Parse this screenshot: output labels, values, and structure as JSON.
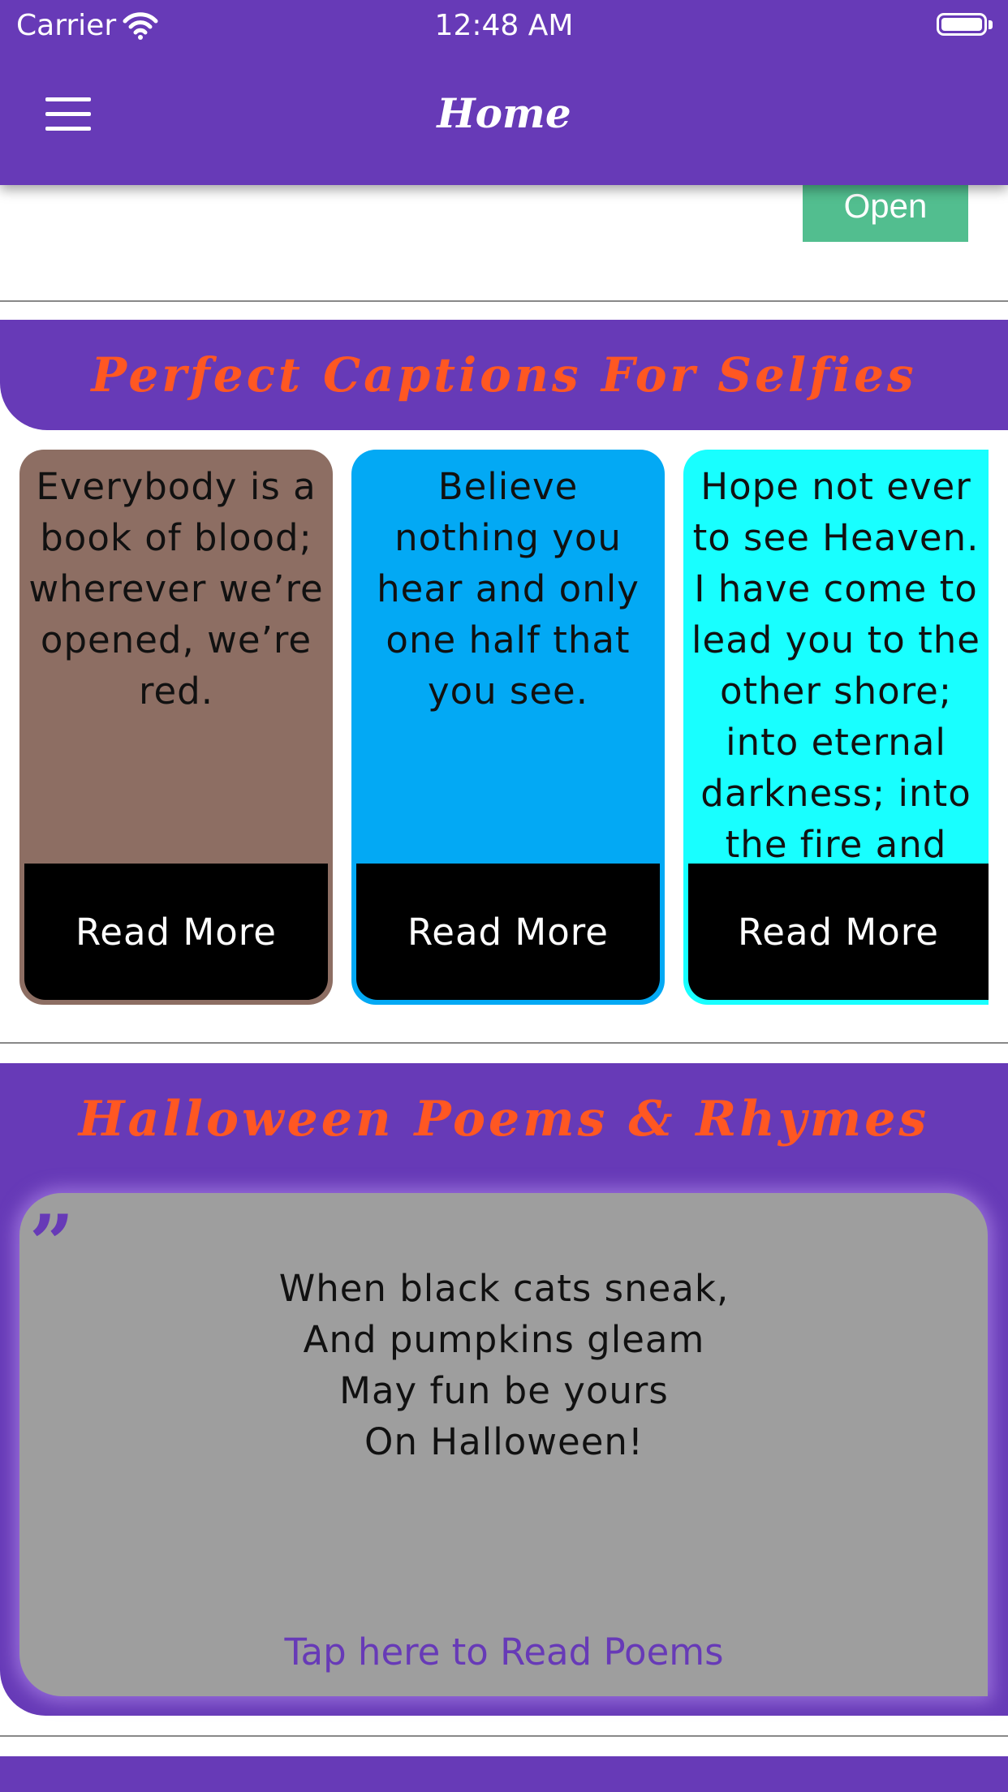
{
  "status_bar": {
    "carrier": "Carrier",
    "time": "12:48 AM"
  },
  "header": {
    "title": "Home",
    "menu_icon": "hamburger-menu-icon"
  },
  "open_button": {
    "label": "Open",
    "color": "#52BE8F"
  },
  "captions": {
    "title": "Perfect Captions For Selfies",
    "title_color": "#FF5722",
    "cards": [
      {
        "text": "Everybody is a book of blood; wherever we’re opened, we’re red.",
        "button": "Read More",
        "color": "#8D6E63"
      },
      {
        "text": "Believe nothing you hear and only one half that you see.",
        "button": "Read More",
        "color": "#03A9F4"
      },
      {
        "text": "Hope not ever to see Heaven. I have come to lead you to the other shore; into eternal darkness; into the fire and into",
        "button": "Read More",
        "color": "#18FFFF"
      }
    ]
  },
  "poems": {
    "title": "Halloween Poems & Rhymes",
    "quote_icon": "quote-icon",
    "lines": [
      "When black cats sneak,",
      "And pumpkins gleam",
      "May fun be yours",
      "On Halloween!"
    ],
    "link": "Tap here to Read Poems"
  },
  "colors": {
    "primary": "#673AB7",
    "accent": "#FF5722",
    "poem_card": "#9E9E9E"
  }
}
